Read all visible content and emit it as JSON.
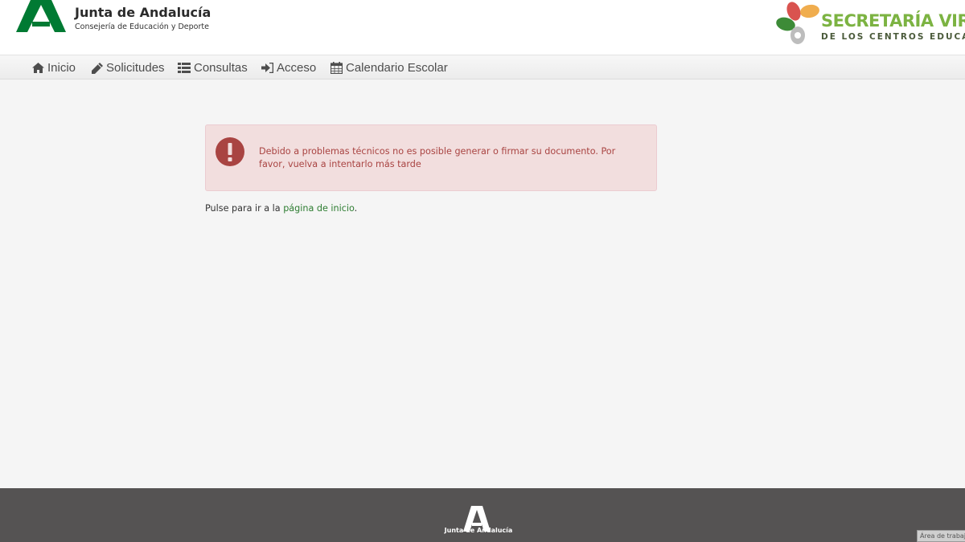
{
  "header": {
    "org_title": "Junta de Andalucía",
    "org_subtitle": "Consejería de Educación y Deporte",
    "portal_title": "SECRETARÍA VIRTU",
    "portal_subtitle": "DE LOS CENTROS EDUCATI"
  },
  "nav": {
    "items": [
      {
        "label": "Inicio",
        "icon": "home-icon"
      },
      {
        "label": "Solicitudes",
        "icon": "pencil-icon"
      },
      {
        "label": "Consultas",
        "icon": "list-icon"
      },
      {
        "label": "Acceso",
        "icon": "sign-in-icon"
      },
      {
        "label": "Calendario Escolar",
        "icon": "calendar-icon"
      }
    ]
  },
  "alert": {
    "icon": "exclamation-circle-icon",
    "message": "Debido a problemas técnicos no es posible generar o firmar su documento. Por favor, vuelva a intentarlo más tarde"
  },
  "return_line": {
    "prefix": "Pulse para ir a la ",
    "link_text": "página de inicio",
    "suffix": "."
  },
  "footer": {
    "org_name": "Junta de Andalucía"
  },
  "tooltip": {
    "text": "Área de trabajo"
  },
  "colors": {
    "brand_green": "#007a33",
    "alert_bg": "#f2dede",
    "alert_text": "#a94442",
    "footer_bg": "#555353",
    "link": "#2e7d32"
  }
}
